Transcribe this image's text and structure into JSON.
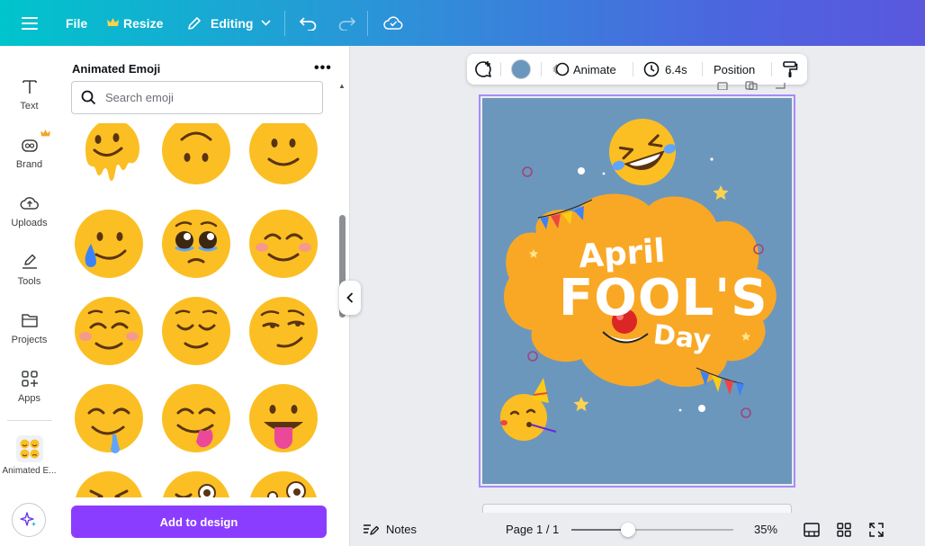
{
  "topbar": {
    "file_label": "File",
    "resize_label": "Resize",
    "editing_label": "Editing"
  },
  "rail": {
    "items": [
      {
        "label": "Text",
        "icon": "text-icon"
      },
      {
        "label": "Brand",
        "icon": "brand-icon"
      },
      {
        "label": "Uploads",
        "icon": "upload-icon"
      },
      {
        "label": "Tools",
        "icon": "pen-icon"
      },
      {
        "label": "Projects",
        "icon": "folder-icon"
      },
      {
        "label": "Apps",
        "icon": "apps-icon"
      },
      {
        "label": "Animated E...",
        "icon": "animated-emoji-icon"
      }
    ]
  },
  "panel": {
    "title": "Animated Emoji",
    "search_placeholder": "Search emoji",
    "add_button": "Add to design",
    "emojis": [
      "melting-face",
      "upside-down-face",
      "slightly-smiling-face",
      "face-holding-back-tears",
      "pleading-face",
      "smiling-face-with-smiling-eyes",
      "smiling-face",
      "relieved-face",
      "smirking-face",
      "drooling-face",
      "face-savoring-food",
      "face-with-tongue",
      "grinning-squinting-face",
      "winking-face",
      "zany-face"
    ]
  },
  "toolbar": {
    "color": "#6c97bd",
    "animate_label": "Animate",
    "duration_label": "6.4s",
    "position_label": "Position"
  },
  "design": {
    "word_april": "April",
    "word_fools": "FOOL'S",
    "word_day": "Day",
    "background_color": "#6c97bd",
    "cloud_color": "#f9a825"
  },
  "bottombar": {
    "notes_label": "Notes",
    "page_label": "Page 1 / 1",
    "zoom_label": "35%",
    "zoom_fraction": 0.35
  }
}
